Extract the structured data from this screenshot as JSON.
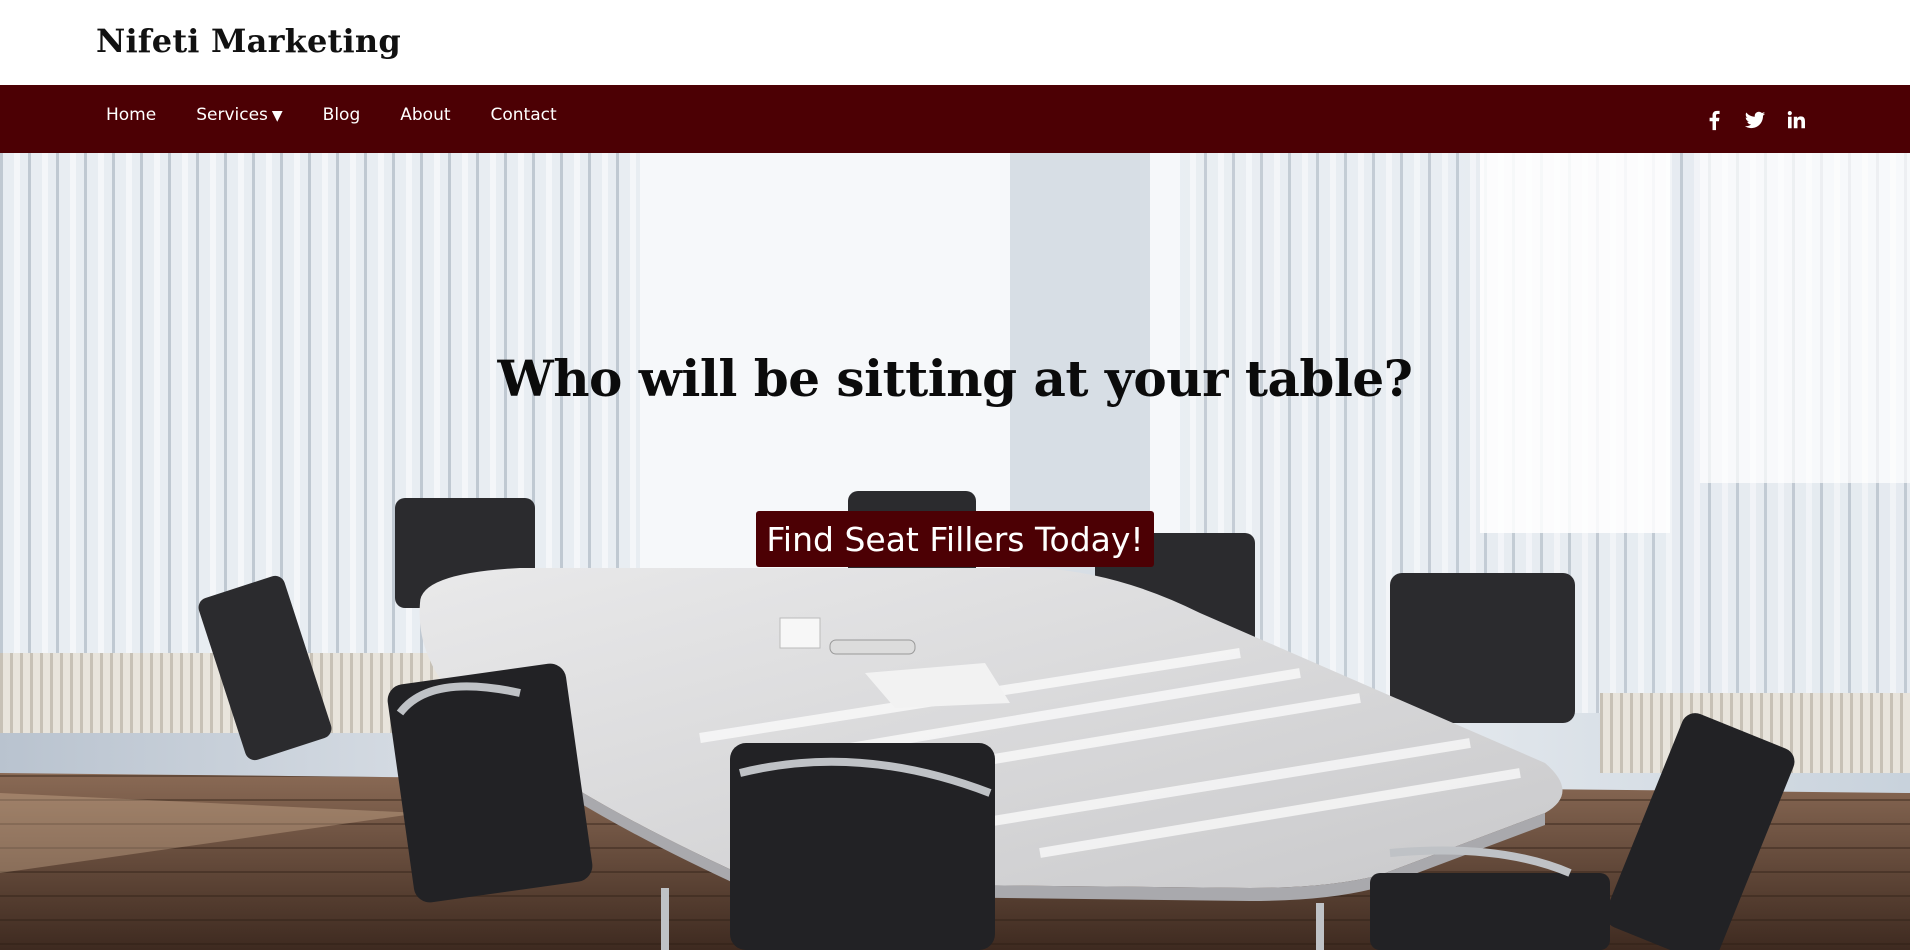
{
  "brand": {
    "name": "Nifeti Marketing"
  },
  "nav": {
    "items": [
      {
        "label": "Home"
      },
      {
        "label": "Services",
        "caret": "▼"
      },
      {
        "label": "Blog"
      },
      {
        "label": "About"
      },
      {
        "label": "Contact"
      }
    ],
    "social": [
      {
        "icon": "facebook-icon"
      },
      {
        "icon": "twitter-icon"
      },
      {
        "icon": "linkedin-icon"
      }
    ]
  },
  "hero": {
    "headline": "Who will be sitting at your table?",
    "cta_label": "Find Seat Fillers Today!"
  },
  "colors": {
    "brand_maroon": "#4c0004",
    "header_bg": "#ffffff",
    "text_dark": "#0b0b0b",
    "text_light": "#ffffff"
  }
}
